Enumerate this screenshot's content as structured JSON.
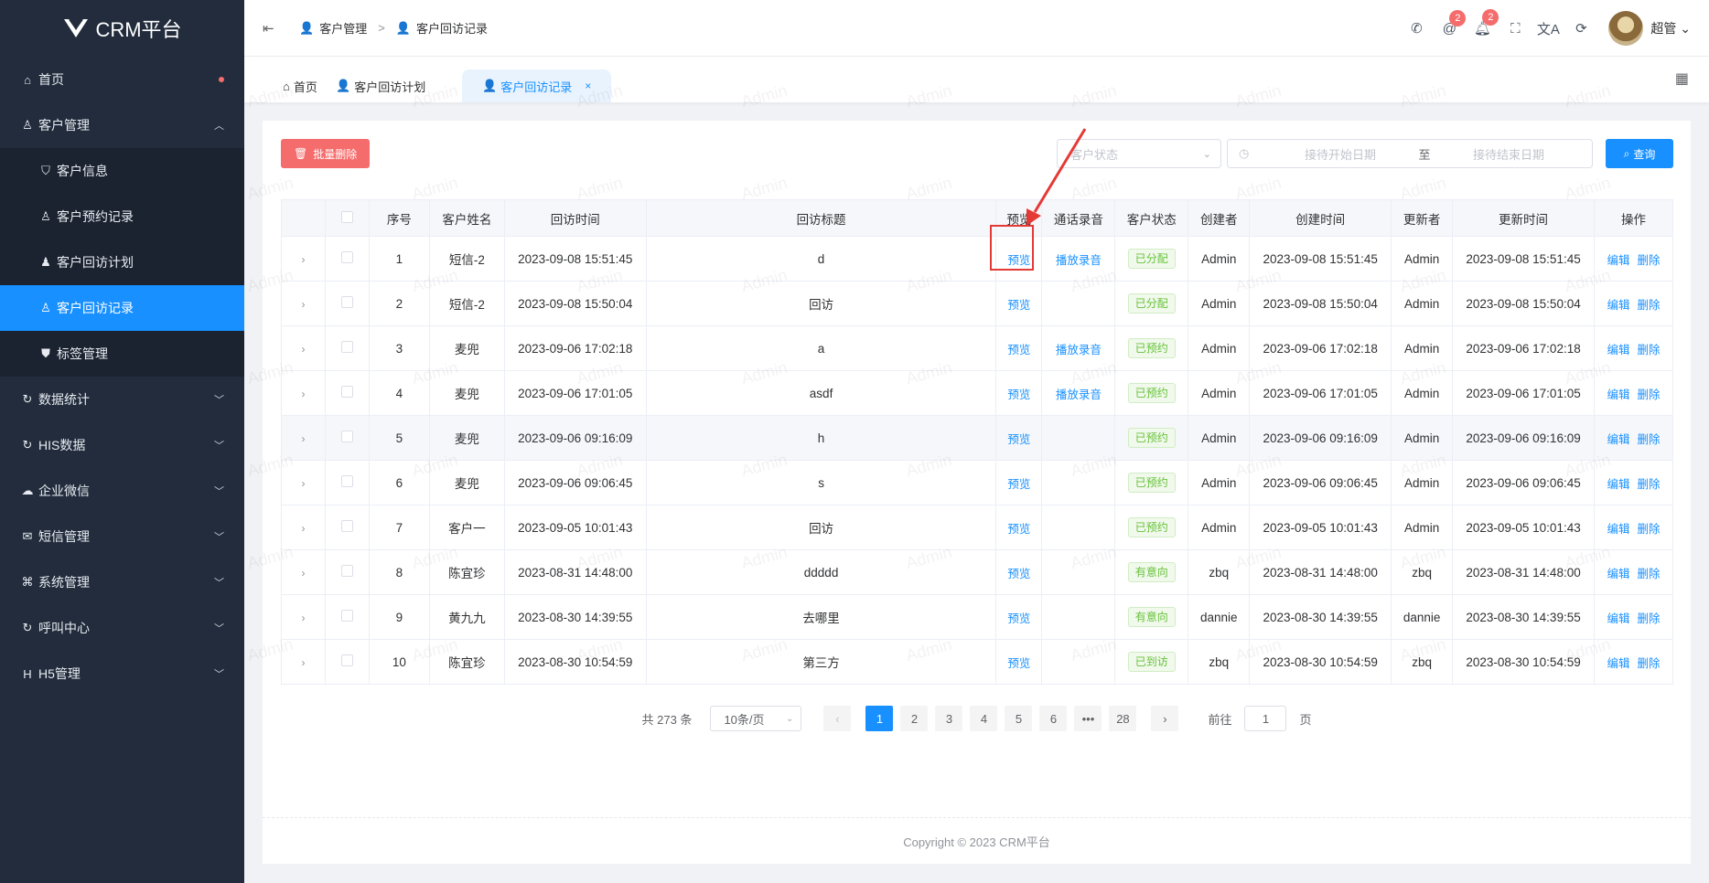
{
  "app": {
    "title": "CRM平台"
  },
  "sidebar": {
    "items": [
      {
        "label": "首页",
        "icon": "home-icon",
        "sub": false
      },
      {
        "label": "客户管理",
        "icon": "user-icon",
        "sub": false
      },
      {
        "label": "客户信息",
        "icon": "shield-icon",
        "sub": true
      },
      {
        "label": "客户预约记录",
        "icon": "user-icon",
        "sub": true
      },
      {
        "label": "客户回访计划",
        "icon": "user-solid-icon",
        "sub": true
      },
      {
        "label": "客户回访记录",
        "icon": "user-icon",
        "sub": true,
        "active": true
      },
      {
        "label": "标签管理",
        "icon": "shield-solid-icon",
        "sub": true
      },
      {
        "label": "数据统计",
        "icon": "refresh-icon",
        "sub": false
      },
      {
        "label": "HIS数据",
        "icon": "refresh-icon",
        "sub": false
      },
      {
        "label": "企业微信",
        "icon": "chat-icon",
        "sub": false
      },
      {
        "label": "短信管理",
        "icon": "sms-icon",
        "sub": false
      },
      {
        "label": "系统管理",
        "icon": "command-icon",
        "sub": false
      },
      {
        "label": "呼叫中心",
        "icon": "refresh-icon",
        "sub": false
      },
      {
        "label": "H5管理",
        "icon": "h5-icon",
        "sub": false
      }
    ]
  },
  "header": {
    "breadcrumb": [
      "客户管理",
      "客户回访记录"
    ],
    "badges": {
      "mention": "2",
      "bell": "2"
    },
    "username": "超管"
  },
  "tabs": [
    {
      "label": "首页"
    },
    {
      "label": "客户回访计划"
    },
    {
      "label": "客户回访记录"
    }
  ],
  "toolbar": {
    "batch_delete": "批量删除",
    "status_placeholder": "客户状态",
    "start_placeholder": "接待开始日期",
    "to": "至",
    "end_placeholder": "接待结束日期",
    "query": "查询"
  },
  "table": {
    "headers": [
      "序号",
      "客户姓名",
      "回访时间",
      "回访标题",
      "预览",
      "通话录音",
      "客户状态",
      "创建者",
      "创建时间",
      "更新者",
      "更新时间",
      "操作"
    ],
    "preview_label": "预览",
    "record_label": "播放录音",
    "edit_label": "编辑",
    "delete_label": "删除",
    "rows": [
      {
        "no": "1",
        "name": "短信-2",
        "time": "2023-09-08 15:51:45",
        "title": "d",
        "record": true,
        "status": "已分配",
        "creator": "Admin",
        "ctime": "2023-09-08 15:51:45",
        "updater": "Admin",
        "utime": "2023-09-08 15:51:45"
      },
      {
        "no": "2",
        "name": "短信-2",
        "time": "2023-09-08 15:50:04",
        "title": "回访",
        "record": false,
        "status": "已分配",
        "creator": "Admin",
        "ctime": "2023-09-08 15:50:04",
        "updater": "Admin",
        "utime": "2023-09-08 15:50:04"
      },
      {
        "no": "3",
        "name": "麦兜",
        "time": "2023-09-06 17:02:18",
        "title": "a",
        "record": true,
        "status": "已预约",
        "creator": "Admin",
        "ctime": "2023-09-06 17:02:18",
        "updater": "Admin",
        "utime": "2023-09-06 17:02:18"
      },
      {
        "no": "4",
        "name": "麦兜",
        "time": "2023-09-06 17:01:05",
        "title": "asdf",
        "record": true,
        "status": "已预约",
        "creator": "Admin",
        "ctime": "2023-09-06 17:01:05",
        "updater": "Admin",
        "utime": "2023-09-06 17:01:05"
      },
      {
        "no": "5",
        "name": "麦兜",
        "time": "2023-09-06 09:16:09",
        "title": "h",
        "record": false,
        "status": "已预约",
        "creator": "Admin",
        "ctime": "2023-09-06 09:16:09",
        "updater": "Admin",
        "utime": "2023-09-06 09:16:09"
      },
      {
        "no": "6",
        "name": "麦兜",
        "time": "2023-09-06 09:06:45",
        "title": "s",
        "record": false,
        "status": "已预约",
        "creator": "Admin",
        "ctime": "2023-09-06 09:06:45",
        "updater": "Admin",
        "utime": "2023-09-06 09:06:45"
      },
      {
        "no": "7",
        "name": "客户一",
        "time": "2023-09-05 10:01:43",
        "title": "回访",
        "record": false,
        "status": "已预约",
        "creator": "Admin",
        "ctime": "2023-09-05 10:01:43",
        "updater": "Admin",
        "utime": "2023-09-05 10:01:43"
      },
      {
        "no": "8",
        "name": "陈宜珍",
        "time": "2023-08-31 14:48:00",
        "title": "ddddd",
        "record": false,
        "status": "有意向",
        "creator": "zbq",
        "ctime": "2023-08-31 14:48:00",
        "updater": "zbq",
        "utime": "2023-08-31 14:48:00"
      },
      {
        "no": "9",
        "name": "黄九九",
        "time": "2023-08-30 14:39:55",
        "title": "去哪里",
        "record": false,
        "status": "有意向",
        "creator": "dannie",
        "ctime": "2023-08-30 14:39:55",
        "updater": "dannie",
        "utime": "2023-08-30 14:39:55"
      },
      {
        "no": "10",
        "name": "陈宜珍",
        "time": "2023-08-30 10:54:59",
        "title": "第三方",
        "record": false,
        "status": "已到访",
        "creator": "zbq",
        "ctime": "2023-08-30 10:54:59",
        "updater": "zbq",
        "utime": "2023-08-30 10:54:59"
      }
    ]
  },
  "pagination": {
    "total": "共 273 条",
    "page_size": "10条/页",
    "pages": [
      "1",
      "2",
      "3",
      "4",
      "5",
      "6",
      "•••",
      "28"
    ],
    "goto_label": "前往",
    "goto_value": "1",
    "page_suffix": "页"
  },
  "footer": {
    "text": "Copyright © 2023 CRM平台"
  },
  "watermark": "Admin",
  "colors": {
    "accent": "#1890ff",
    "danger": "#f56c6c",
    "success": "#67c23a",
    "sidebar": "#222c3c"
  }
}
